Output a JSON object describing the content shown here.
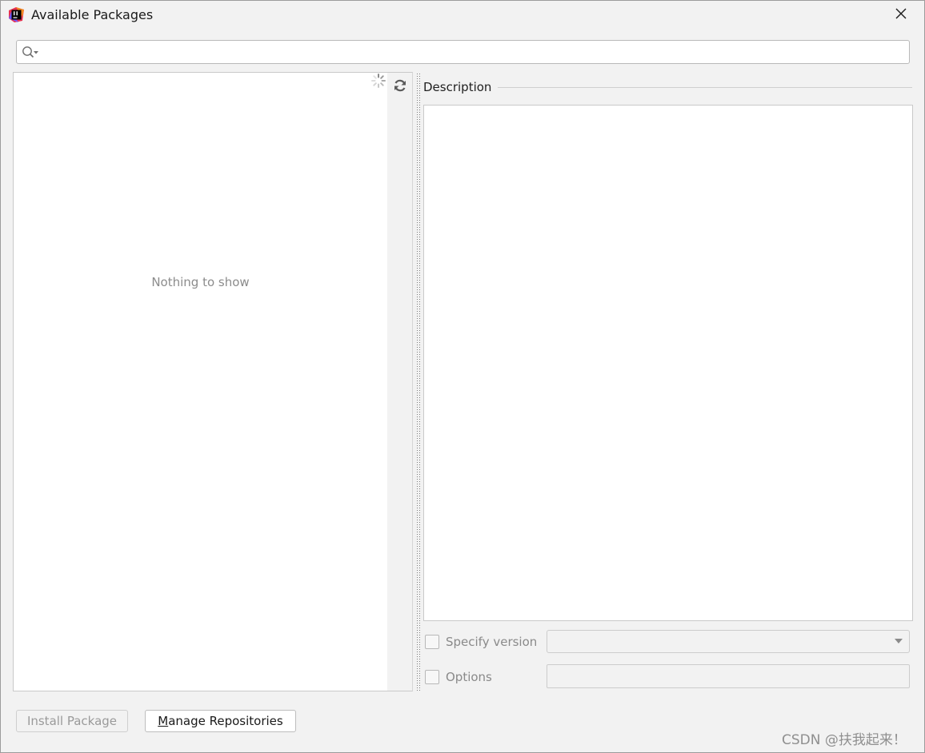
{
  "window": {
    "title": "Available Packages",
    "app_icon": "intellij-icon",
    "close_icon": "close-icon"
  },
  "search": {
    "value": "",
    "placeholder": "",
    "icon": "search-icon"
  },
  "package_list": {
    "empty_text": "Nothing to show",
    "loading_icon": "spinner-icon",
    "refresh_icon": "refresh-icon"
  },
  "description": {
    "label": "Description",
    "content": ""
  },
  "specify_version": {
    "label": "Specify version",
    "checked": false,
    "selected": ""
  },
  "options": {
    "label": "Options",
    "checked": false,
    "value": ""
  },
  "buttons": {
    "install_prefix": "Install Package",
    "manage_mnemonic": "M",
    "manage_rest": "anage Repositories"
  },
  "watermark": "CSDN @扶我起来！",
  "colors": {
    "window_bg": "#f2f2f2",
    "panel_bg": "#ffffff",
    "border": "#c9c9c9",
    "muted_text": "#8c8c8c"
  }
}
